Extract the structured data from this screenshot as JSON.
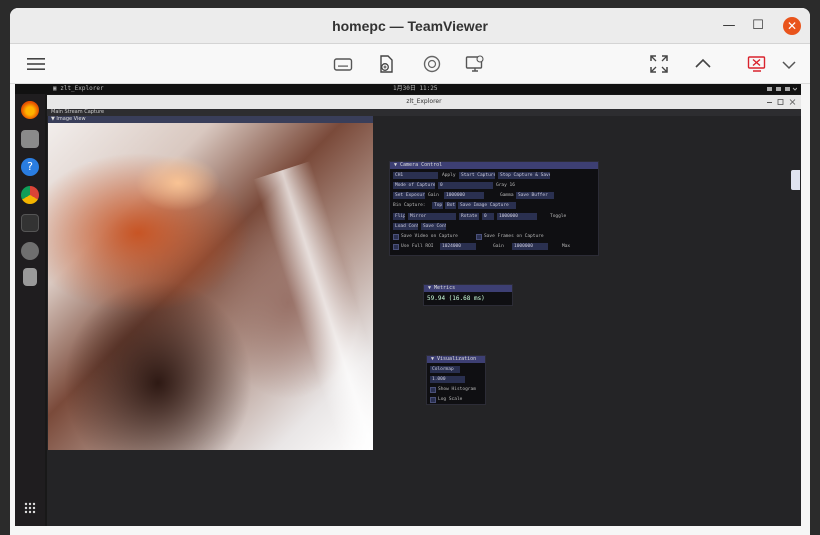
{
  "teamviewer": {
    "title": "homepc — TeamViewer",
    "window_controls": {
      "minimize": "—",
      "maximize": "☐",
      "close": "✕"
    },
    "toolbar": {
      "menu_icon": "hamburger-menu-icon",
      "actions": [
        "keyboard-icon",
        "file-transfer-icon",
        "record-icon",
        "remote-screen-icon"
      ],
      "right_actions": [
        "fullscreen-icon",
        "collapse-up-icon",
        "end-session-icon",
        "chevron-down-icon"
      ]
    },
    "colors": {
      "accent": "#e9541c",
      "end_session": "#d9232d"
    }
  },
  "remote": {
    "topbar": {
      "left": "▣ zlt_Explorer",
      "center": "1月30日 11:25"
    },
    "dock_icons": [
      "firefox-icon",
      "files-icon",
      "help-icon",
      "chrome-icon",
      "terminal-icon",
      "settings-icon",
      "trash-icon",
      "app-grid-icon"
    ],
    "app_window": {
      "title": "zlt_Explorer",
      "menubar": "Main  Stream  Capture",
      "image_window_title": "▼ Image View",
      "camera_panel": {
        "title": "▼ Camera Control",
        "rows": [
          [
            "CH1",
            "Apply",
            "Start Capture",
            "Stop Capture & Save"
          ],
          [
            "Mode of Capture",
            "0",
            "Gray 16"
          ],
          [
            "Set Exposure",
            "Gain",
            "1000000",
            "Gamma",
            "Save Buffer"
          ],
          [
            "Bin Capture:",
            "Top",
            "Bot",
            "Save Image Capture"
          ],
          [
            "Flip",
            "Mirror",
            "Rotate",
            "0",
            "1000000",
            "Toggle"
          ],
          [
            "Load Conf",
            "Save Conf"
          ],
          [
            "Save Video on Capture",
            "Save Frames on Capture"
          ],
          [
            "Use Full ROI",
            "1024000",
            "Gain",
            "1000000",
            "Max"
          ]
        ]
      },
      "metrics_panel": {
        "title": "▼ Metrics",
        "fps": "59.94 (16.68 ms)"
      },
      "tools_panel": {
        "title": "▼ Visualization",
        "rows": [
          "Colormap",
          "1.000",
          "Show Histogram",
          "Log Scale"
        ]
      }
    }
  }
}
